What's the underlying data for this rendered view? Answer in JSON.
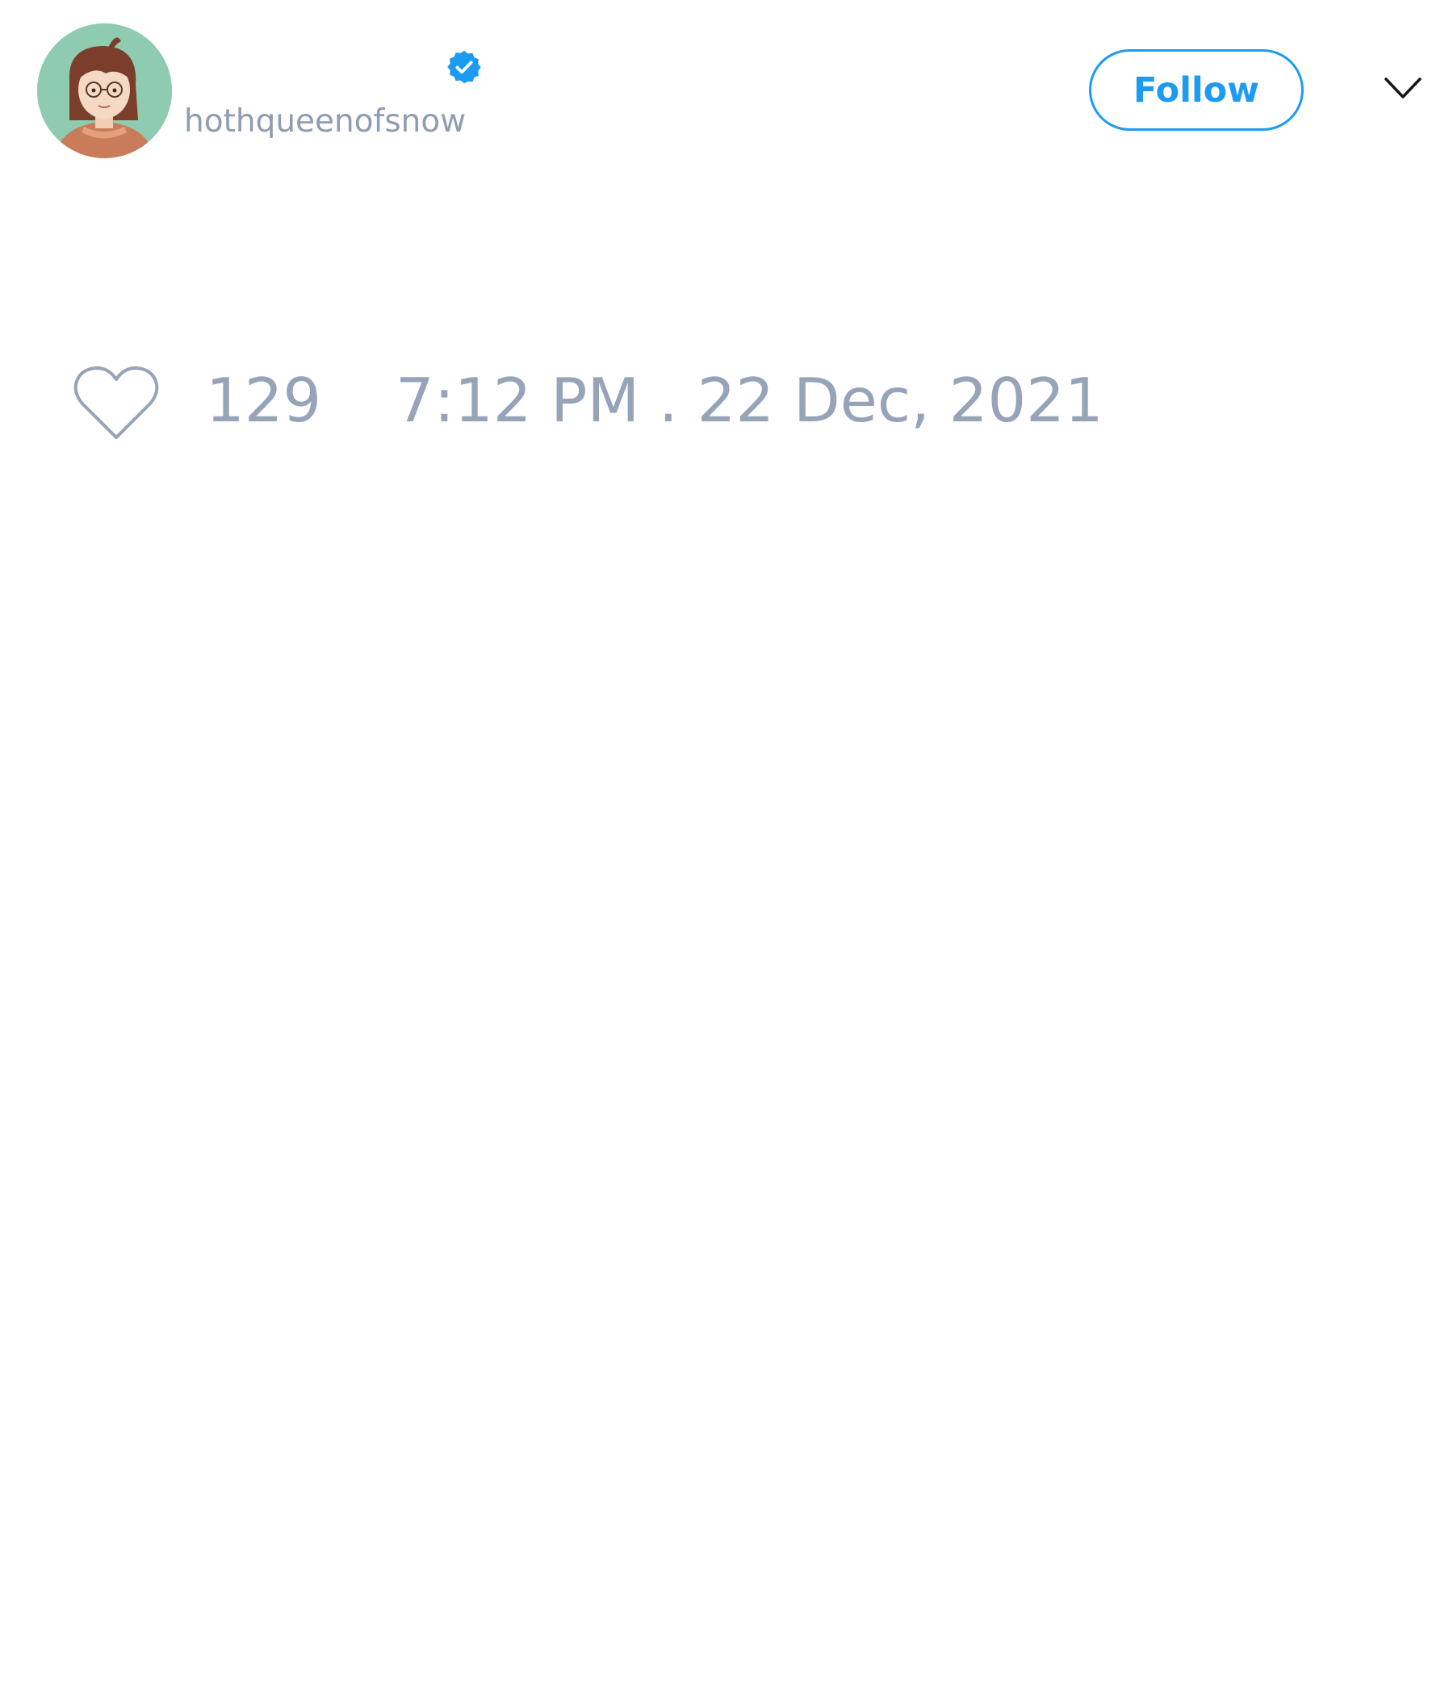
{
  "author": {
    "display_name": "",
    "handle": "hothqueenofsnow",
    "verified": true,
    "avatar_icon": "avatar-illustration-icon",
    "verified_icon": "verified-badge-icon"
  },
  "header": {
    "follow_label": "Follow",
    "menu_icon": "chevron-down-icon"
  },
  "engagement": {
    "like_icon": "heart-outline-icon",
    "like_count": "129",
    "timestamp": "7:12 PM . 22 Dec, 2021"
  },
  "colors": {
    "accent": "#1d9bf0",
    "muted_text": "#96a3b9",
    "background": "#ffffff"
  }
}
